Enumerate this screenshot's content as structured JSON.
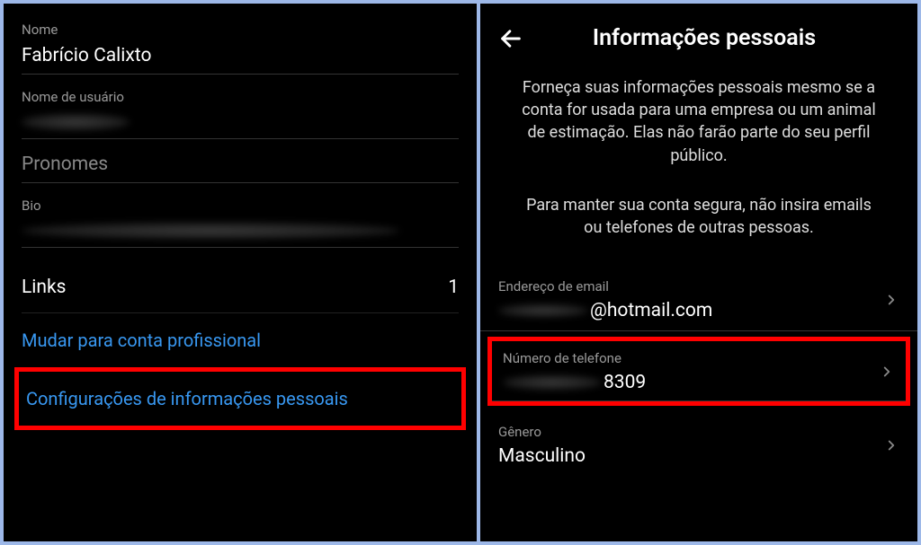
{
  "left": {
    "name_label": "Nome",
    "name_value": "Fabrício Calixto",
    "username_label": "Nome de usuário",
    "pronouns_label": "Pronomes",
    "bio_label": "Bio",
    "links_label": "Links",
    "links_count": "1",
    "switch_account": "Mudar para conta profissional",
    "personal_info": "Configurações de informações pessoais"
  },
  "right": {
    "header_title": "Informações pessoais",
    "info_paragraph_1": "Forneça suas informações pessoais mesmo se a conta for usada para uma empresa ou um animal de estimação. Elas não farão parte do seu perfil público.",
    "info_paragraph_2": "Para manter sua conta segura, não insira emails ou telefones de outras pessoas.",
    "email_label": "Endereço de email",
    "email_suffix": "@hotmail.com",
    "phone_label": "Número de telefone",
    "phone_suffix": "8309",
    "gender_label": "Gênero",
    "gender_value": "Masculino"
  }
}
